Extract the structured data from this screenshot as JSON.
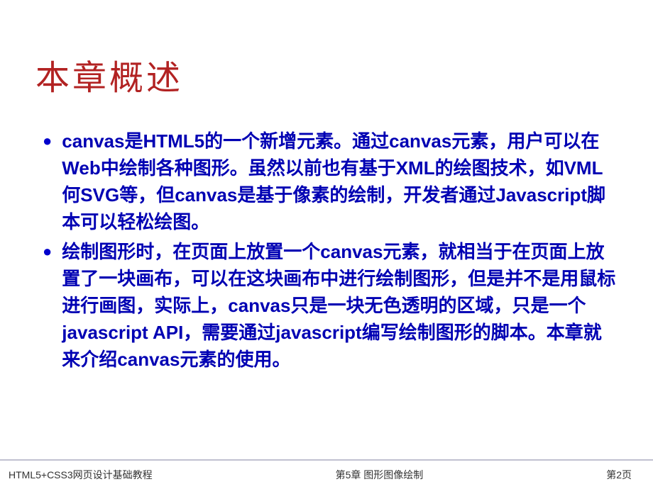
{
  "title": "本章概述",
  "bullets": [
    "canvas是HTML5的一个新增元素。通过canvas元素，用户可以在Web中绘制各种图形。虽然以前也有基于XML的绘图技术，如VML何SVG等，但canvas是基于像素的绘制，开发者通过Javascript脚本可以轻松绘图。",
    "绘制图形时，在页面上放置一个canvas元素，就相当于在页面上放置了一块画布，可以在这块画布中进行绘制图形，但是并不是用鼠标进行画图，实际上，canvas只是一块无色透明的区域，只是一个javascript API，需要通过javascript编写绘制图形的脚本。本章就来介绍canvas元素的使用。"
  ],
  "footer": {
    "left": "HTML5+CSS3网页设计基础教程",
    "center": "第5章  图形图像绘制",
    "right": "第2页"
  }
}
